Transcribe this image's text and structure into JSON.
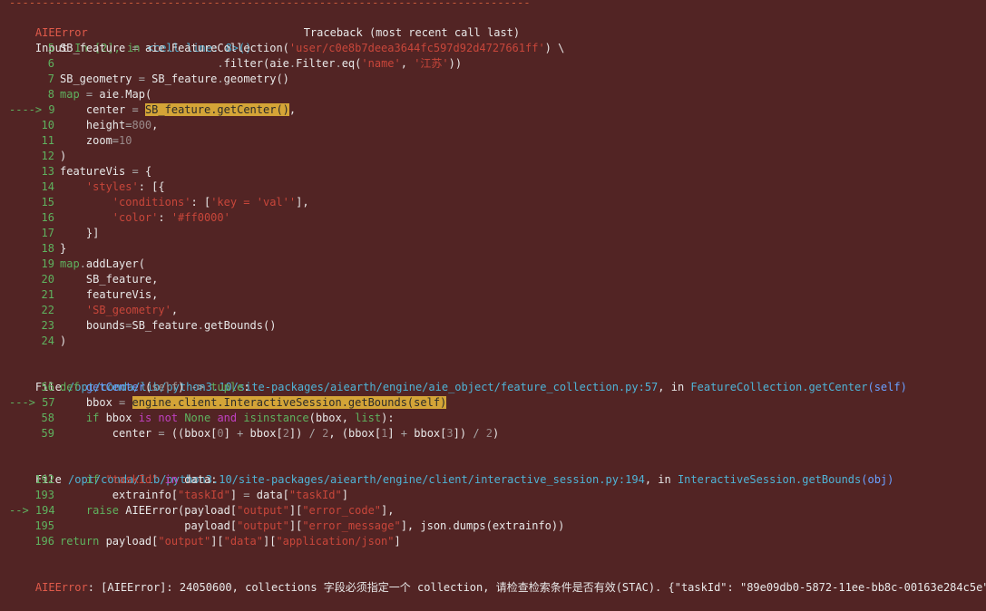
{
  "header": {
    "error_name": "AIEError",
    "traceback_title": "Traceback (most recent call last)",
    "input_prefix": "Input",
    "input_in": "In [2], in",
    "input_cell": "<cell line: 8>()"
  },
  "frame1": {
    "lines": [
      {
        "n": "5",
        "t": "SB_feature = aie.FeatureCollection('user/c0e8b7deea3644fc597d92d4727661ff') \\"
      },
      {
        "n": "6",
        "t": "                        .filter(aie.Filter.eq('name', '江苏'))"
      },
      {
        "n": "7",
        "t": "SB_geometry = SB_feature.geometry()"
      },
      {
        "n": "8",
        "t": "map = aie.Map("
      },
      {
        "n": "9",
        "t": "    center = SB_feature.getCenter(),"
      },
      {
        "n": "10",
        "t": "    height=800,"
      },
      {
        "n": "11",
        "t": "    zoom=10"
      },
      {
        "n": "12",
        "t": ")"
      },
      {
        "n": "13",
        "t": "featureVis = {"
      },
      {
        "n": "14",
        "t": "    'styles': [{"
      },
      {
        "n": "15",
        "t": "        'conditions': ['key = 'val''],"
      },
      {
        "n": "16",
        "t": "        'color': '#ff0000'"
      },
      {
        "n": "17",
        "t": "    }]"
      },
      {
        "n": "18",
        "t": "}"
      },
      {
        "n": "19",
        "t": "map.addLayer("
      },
      {
        "n": "20",
        "t": "    SB_feature,"
      },
      {
        "n": "21",
        "t": "    featureVis,"
      },
      {
        "n": "22",
        "t": "    'SB_geometry',"
      },
      {
        "n": "23",
        "t": "    bounds=SB_feature.getBounds()"
      },
      {
        "n": "24",
        "t": ")"
      }
    ]
  },
  "frame2": {
    "file_label": "File",
    "path": "/opt/conda/lib/python3.10/site-packages/aiearth/engine/aie_object/feature_collection.py:57",
    "in_label": ", in",
    "func": "FeatureCollection.getCenter",
    "args": "(self)"
  },
  "frame3": {
    "file_label": "File",
    "path": "/opt/conda/lib/python3.10/site-packages/aiearth/engine/client/interactive_session.py:194",
    "in_label": ", in",
    "func": "InteractiveSession.getBounds",
    "args": "(obj)"
  },
  "footer": {
    "error_name": "AIEError",
    "message": ": [AIEError]: 24050600, collections 字段必须指定一个 collection, 请检查检索条件是否有效(STAC). {\"taskId\": \"89e09db0-5872-11ee-bb8c-00163e284c5e\"}"
  },
  "colors": {
    "background": "#522424",
    "error_red": "#e05a4a",
    "line_number_green": "#5fb25f",
    "path_cyan": "#4fb3d6",
    "highlight_yellow": "#d4a437"
  }
}
